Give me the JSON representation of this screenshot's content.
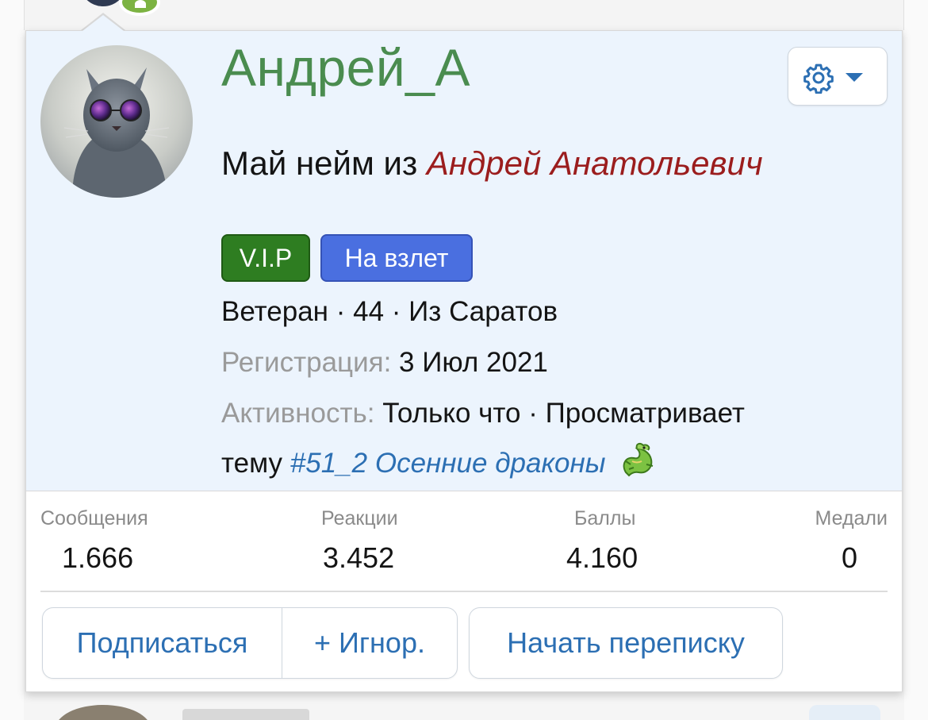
{
  "profile": {
    "username": "Андрей_А",
    "title_prefix": "Май нейм из ",
    "title_name": "Андрей Анатольевич",
    "badges": [
      "V.I.P",
      "На взлет"
    ],
    "meta": "Ветеран · 44 · Из Саратов",
    "registration_label": "Регистрация:",
    "registration_value": " 3 Июл 2021",
    "activity_label": "Активность:",
    "activity_value": " Только что · Просматривает",
    "activity_prefix": "тему ",
    "activity_thread": "#51_2 Осенние драконы"
  },
  "stats": [
    {
      "label": "Сообщения",
      "value": "1.666"
    },
    {
      "label": "Реакции",
      "value": "3.452"
    },
    {
      "label": "Баллы",
      "value": "4.160"
    },
    {
      "label": "Медали",
      "value": "0"
    }
  ],
  "actions": {
    "follow": "Подписаться",
    "ignore": "+ Игнор.",
    "message": "Начать переписку"
  },
  "icons": {
    "settings": "gear-icon",
    "dropdown": "caret-down-icon",
    "dragon": "dragon-emoji-icon"
  },
  "colors": {
    "username": "#4a8c4f",
    "real_name": "#9b1d1d",
    "link": "#2c6fb3",
    "badge_vip": "#2e7d21",
    "badge_up": "#4a6fe0",
    "header_bg": "#ecf4fd"
  }
}
